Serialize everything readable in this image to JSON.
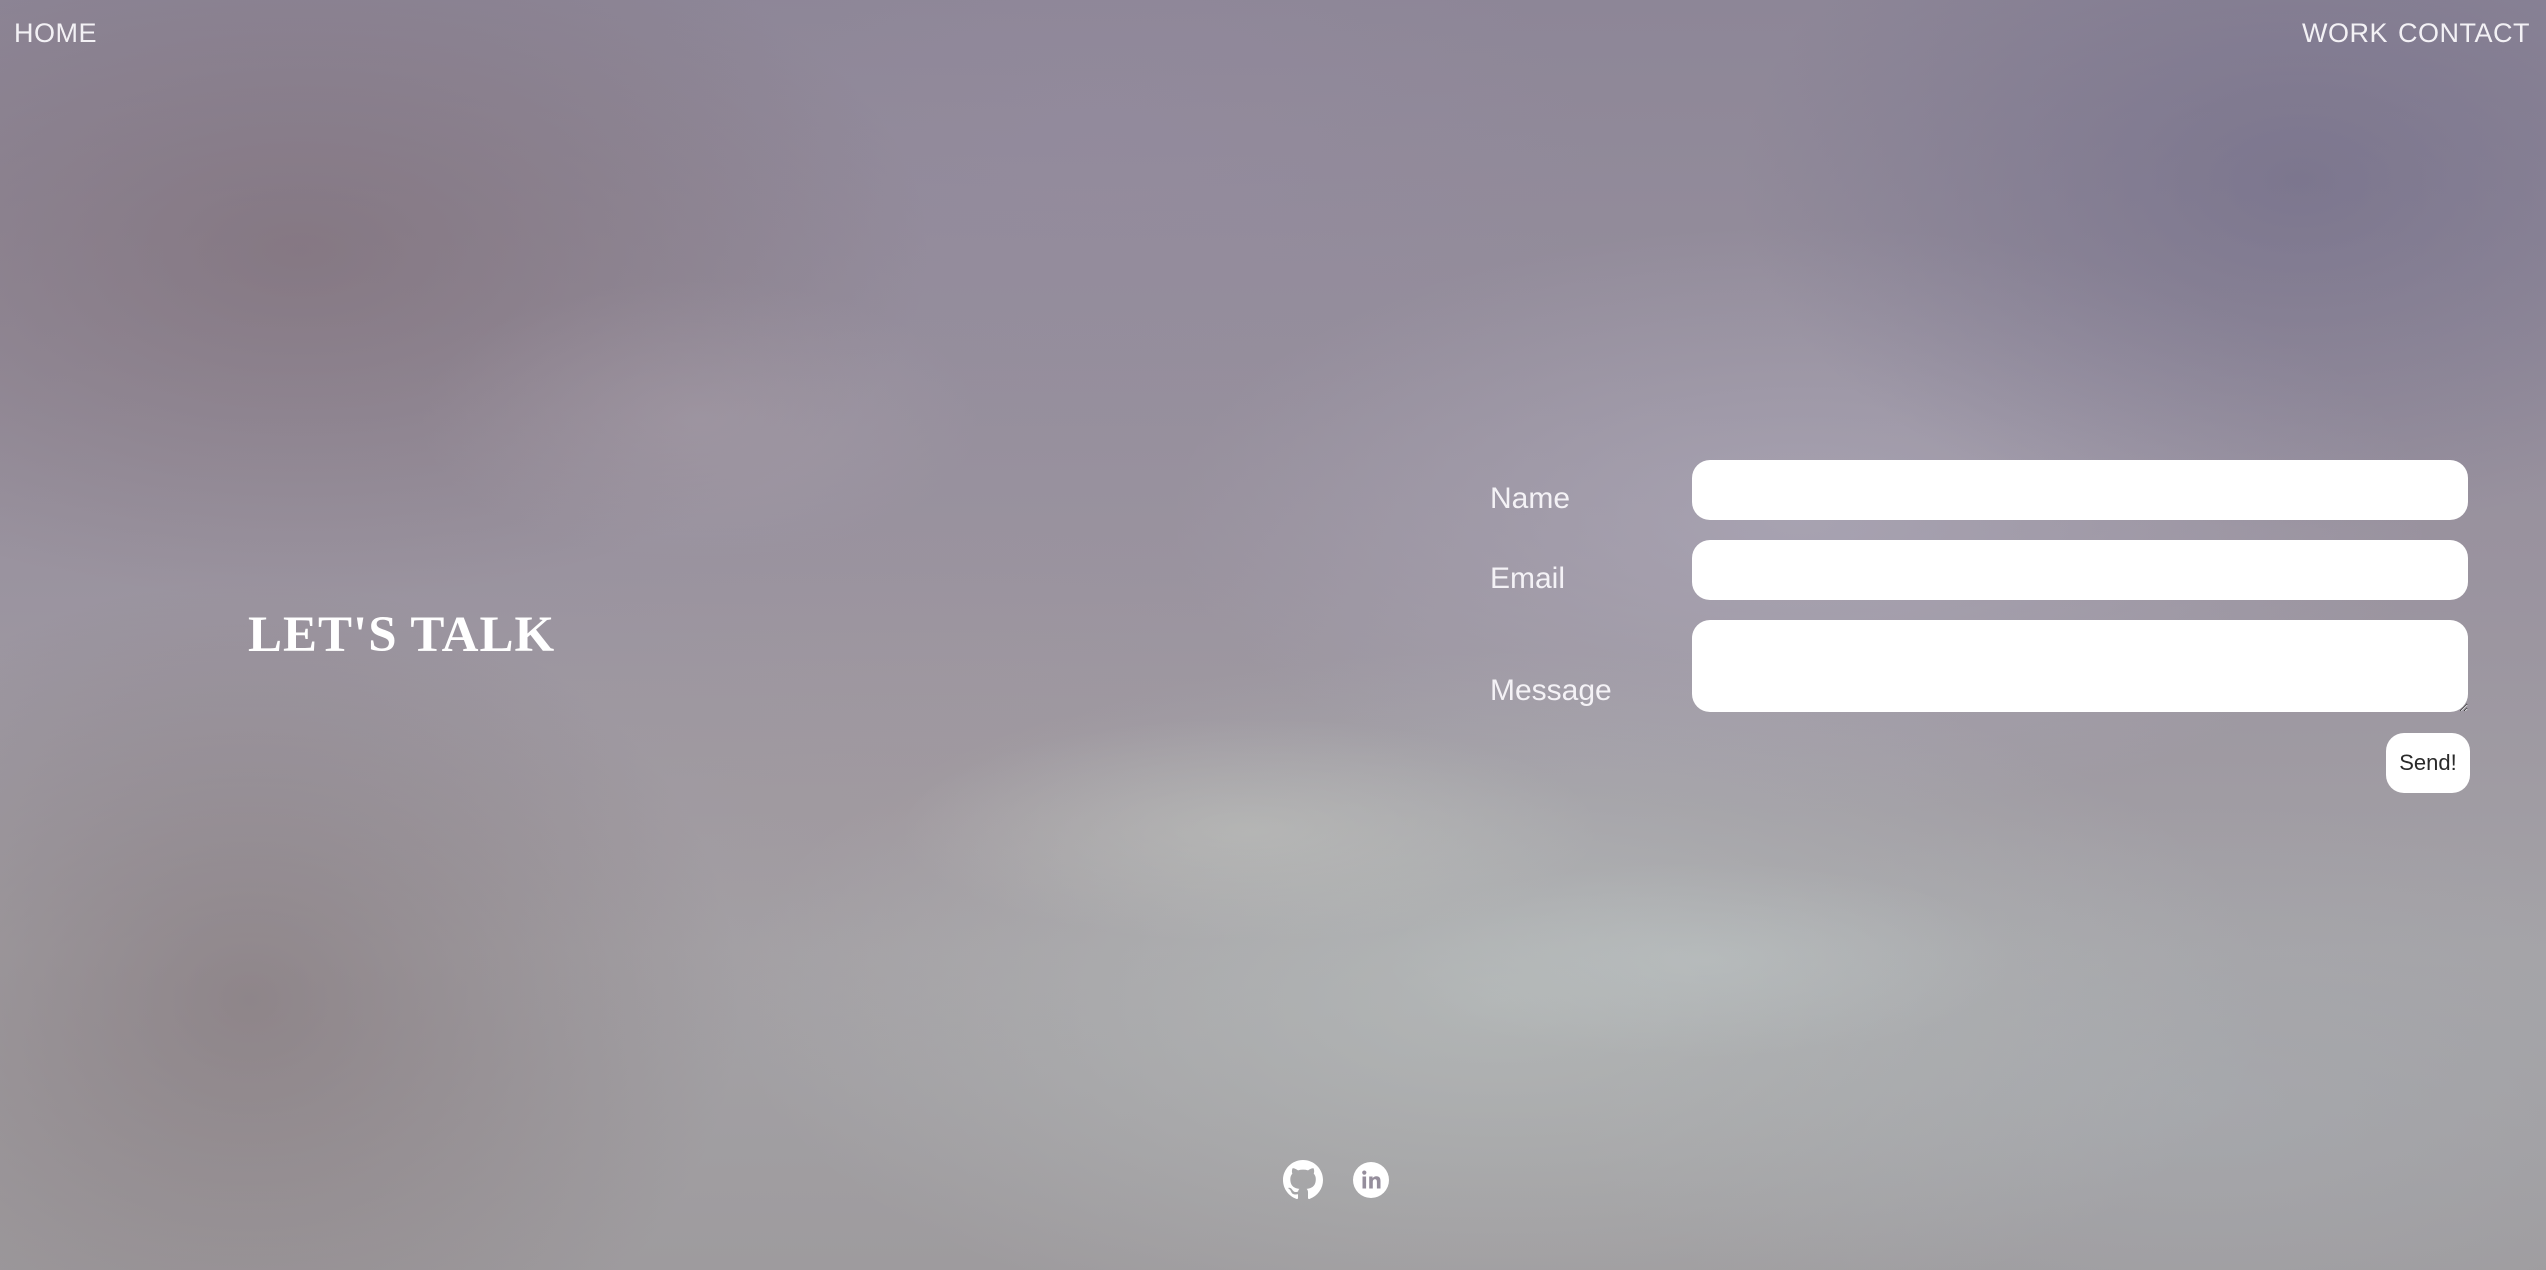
{
  "nav": {
    "home": "HOME",
    "work": "WORK",
    "contact": "CONTACT"
  },
  "hero": {
    "heading": "LET'S TALK"
  },
  "form": {
    "name_label": "Name",
    "email_label": "Email",
    "message_label": "Message",
    "name_value": "",
    "email_value": "",
    "message_value": "",
    "send_label": "Send!"
  },
  "social": {
    "icons": [
      "github-icon",
      "linkedin-icon"
    ]
  },
  "colors": {
    "text": "#ffffff",
    "field_bg": "#ffffff"
  }
}
